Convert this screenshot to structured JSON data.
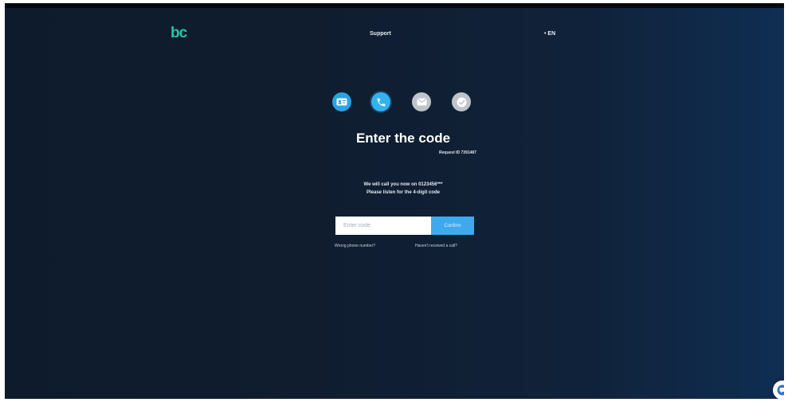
{
  "header": {
    "logo_text": "bc",
    "support_label": "Support",
    "language_label": "• EN"
  },
  "steps": [
    {
      "name": "id-card-icon",
      "state": "done"
    },
    {
      "name": "phone-icon",
      "state": "active"
    },
    {
      "name": "envelope-icon",
      "state": "pending"
    },
    {
      "name": "check-icon",
      "state": "pending"
    }
  ],
  "main": {
    "title": "Enter the code",
    "request_id": "Request ID 7391487",
    "info_line1": "We will call you now on 0123456***",
    "info_line2": "Please listen for the 4-digit code"
  },
  "form": {
    "code_placeholder": "Enter code",
    "code_value": "",
    "confirm_label": "Confirm"
  },
  "links": {
    "wrong_phone": "Wrong phone number?",
    "resend": "Haven't received a call?"
  },
  "colors": {
    "accent": "#3fa9ee",
    "logo": "#26c6a4",
    "background": "#0f1d2f"
  }
}
